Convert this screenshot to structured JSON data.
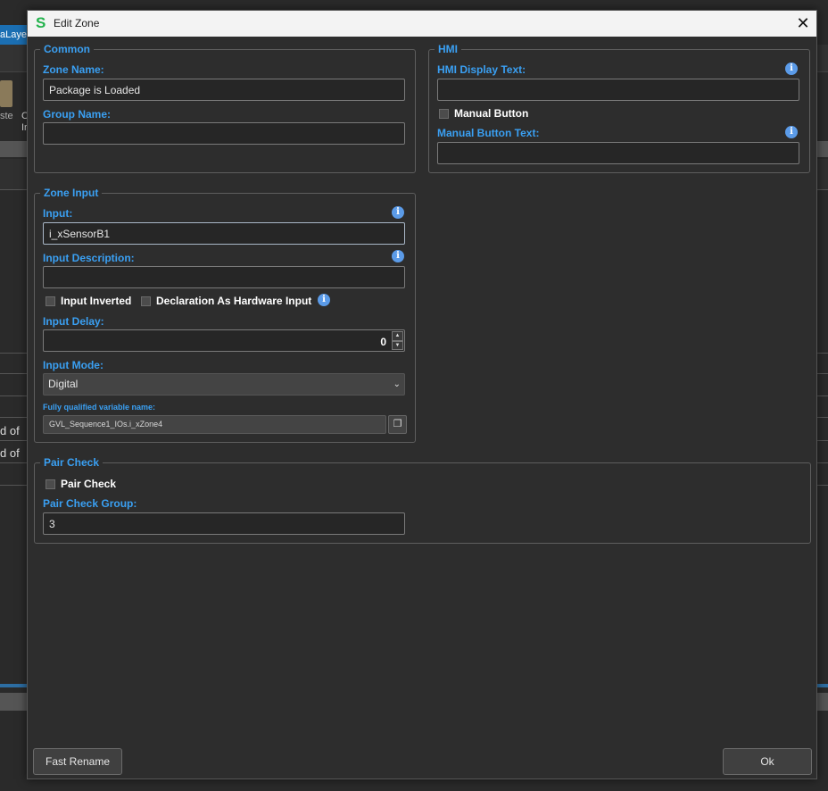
{
  "background": {
    "ribbon_tab": "aLayer",
    "paste_label": "ste",
    "letter_a": "C",
    "letter_b": "Ir",
    "row_text_1": "d of",
    "row_text_2": "d of"
  },
  "dialog": {
    "title": "Edit Zone",
    "app_logo": "S",
    "close_glyph": "✕",
    "info_glyph": "i"
  },
  "common": {
    "legend": "Common",
    "zone_name_label": "Zone Name:",
    "zone_name_value": "Package is Loaded",
    "group_name_label": "Group Name:",
    "group_name_value": ""
  },
  "hmi": {
    "legend": "HMI",
    "display_text_label": "HMI Display Text:",
    "display_text_value": "",
    "manual_button_label": "Manual Button",
    "manual_button_checked": false,
    "manual_button_text_label": "Manual Button Text:",
    "manual_button_text_value": ""
  },
  "zone_input": {
    "legend": "Zone Input",
    "input_label": "Input:",
    "input_value": "i_xSensorB1",
    "input_description_label": "Input Description:",
    "input_description_value": "",
    "input_inverted_label": "Input Inverted",
    "declaration_hw_label": "Declaration As Hardware Input",
    "input_delay_label": "Input Delay:",
    "input_delay_value": "0",
    "input_mode_label": "Input Mode:",
    "input_mode_value": "Digital",
    "fqvn_label": "Fully qualified variable name:",
    "fqvn_value": "GVL_Sequence1_IOs.i_xZone4"
  },
  "pair_check": {
    "legend": "Pair Check",
    "pair_check_label": "Pair Check",
    "pair_check_group_label": "Pair Check Group:",
    "pair_check_group_value": "3"
  },
  "footer": {
    "fast_rename": "Fast Rename",
    "ok": "Ok"
  },
  "colors": {
    "accent": "#3aa0f3",
    "logo": "#22b24c",
    "info": "#5b9be8"
  }
}
